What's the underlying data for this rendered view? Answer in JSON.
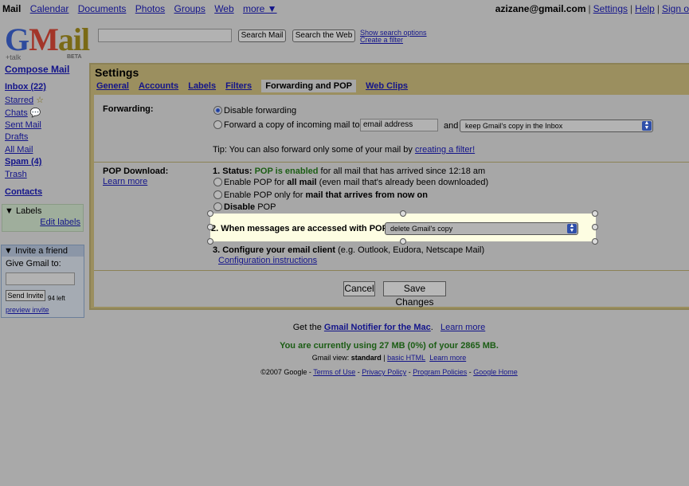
{
  "topnav": {
    "items": [
      "Mail",
      "Calendar",
      "Documents",
      "Photos",
      "Groups",
      "Web",
      "more ▼"
    ],
    "account_email": "azizane@gmail.com",
    "settings_link": "Settings",
    "help_link": "Help",
    "signout_link": "Sign o"
  },
  "logo": {
    "g": "G",
    "m": "M",
    "ai": "ail",
    "talk": "+talk",
    "beta": "BETA"
  },
  "search": {
    "value": "",
    "search_mail": "Search Mail",
    "search_web": "Search the Web",
    "show_options": "Show search options",
    "create_filter": "Create a filter"
  },
  "sidebar": {
    "compose": "Compose Mail",
    "items": [
      "Inbox (22)",
      "Starred",
      "Chats",
      "Sent Mail",
      "Drafts",
      "All Mail",
      "Spam (4)",
      "Trash"
    ],
    "contacts": "Contacts",
    "labels_header": "Labels",
    "edit_labels": "Edit labels",
    "invite_header": "Invite a friend",
    "give_label": "Give Gmail to:",
    "send_invite": "Send Invite",
    "left_count": "94 left",
    "preview_invite": "preview invite"
  },
  "settings": {
    "title": "Settings",
    "tabs": [
      "General",
      "Accounts",
      "Labels",
      "Filters",
      "Forwarding and POP",
      "Web Clips"
    ],
    "forwarding": {
      "label": "Forwarding:",
      "disable": "Disable forwarding",
      "forward_copy": "Forward a copy of incoming mail to",
      "email_value": "email address",
      "and": "and",
      "copy_select": "keep Gmail's copy in the Inbox",
      "tip_prefix": "Tip: You can also forward only some of your mail by ",
      "tip_link": "creating a filter!"
    },
    "pop": {
      "label": "POP Download:",
      "learn_more": "Learn more",
      "status_prefix": "1. Status: ",
      "status_enabled": "POP is enabled",
      "status_suffix": " for all mail that has arrived since 12:18 am",
      "opt1_prefix": "Enable POP for ",
      "opt1_bold": "all mail",
      "opt1_suffix": " (even mail that's already been downloaded)",
      "opt2_prefix": "Enable POP only for ",
      "opt2_bold": "mail that arrives from now on",
      "opt3_bold": "Disable",
      "opt3_suffix": " POP",
      "step2": "2. When messages are accessed with POP",
      "step2_select": "delete Gmail's copy",
      "step3_bold": "3. Configure your email client",
      "step3_suffix": " (e.g. Outlook, Eudora, Netscape Mail)",
      "config_link": "Configuration instructions"
    },
    "cancel": "Cancel",
    "save": "Save Changes"
  },
  "footer": {
    "notifier_prefix": "Get the ",
    "notifier_link": "Gmail Notifier for the Mac",
    "notifier_suffix": ".",
    "notifier_learn": "Learn more",
    "usage": "You are currently using 27 MB (0%) of your 2865 MB.",
    "view_prefix": "Gmail view: ",
    "view_current": "standard",
    "view_sep": " | ",
    "view_basic": "basic HTML",
    "view_learn": "Learn more",
    "copyright": "©2007 Google - ",
    "terms": "Terms of Use",
    "privacy": "Privacy Policy",
    "program": "Program Policies",
    "home": "Google Home",
    "dash": " - "
  }
}
